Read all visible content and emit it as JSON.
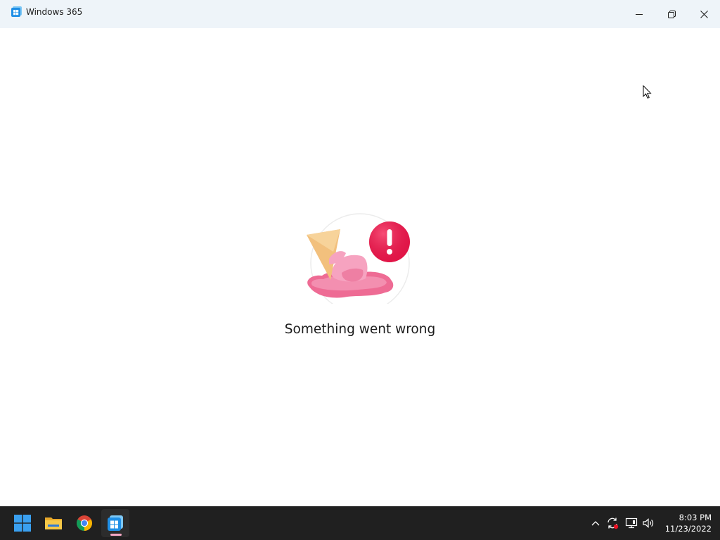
{
  "window": {
    "title": "Windows 365",
    "icon": "windows-365-icon",
    "controls": {
      "minimize_icon": "minimize-icon",
      "maximize_icon": "restore-icon",
      "close_icon": "close-icon"
    }
  },
  "error": {
    "illustration": "melted-ice-cream-error-illustration",
    "message": "Something went wrong"
  },
  "taskbar": {
    "pinned": [
      {
        "name": "start-button",
        "icon": "windows-logo-icon"
      },
      {
        "name": "file-explorer",
        "icon": "folder-icon"
      },
      {
        "name": "google-chrome",
        "icon": "chrome-icon"
      },
      {
        "name": "windows-365",
        "icon": "windows-365-icon",
        "active": true
      }
    ],
    "tray": {
      "icons": [
        "chevron-up-icon",
        "sync-icon",
        "network-icon",
        "volume-icon"
      ],
      "time": "8:03 PM",
      "date": "11/23/2022"
    }
  },
  "colors": {
    "titlebar": "#eef4f9",
    "taskbar": "#202020",
    "error_red": "#e8174a",
    "ice_cream_pink": "#ee6b94"
  }
}
